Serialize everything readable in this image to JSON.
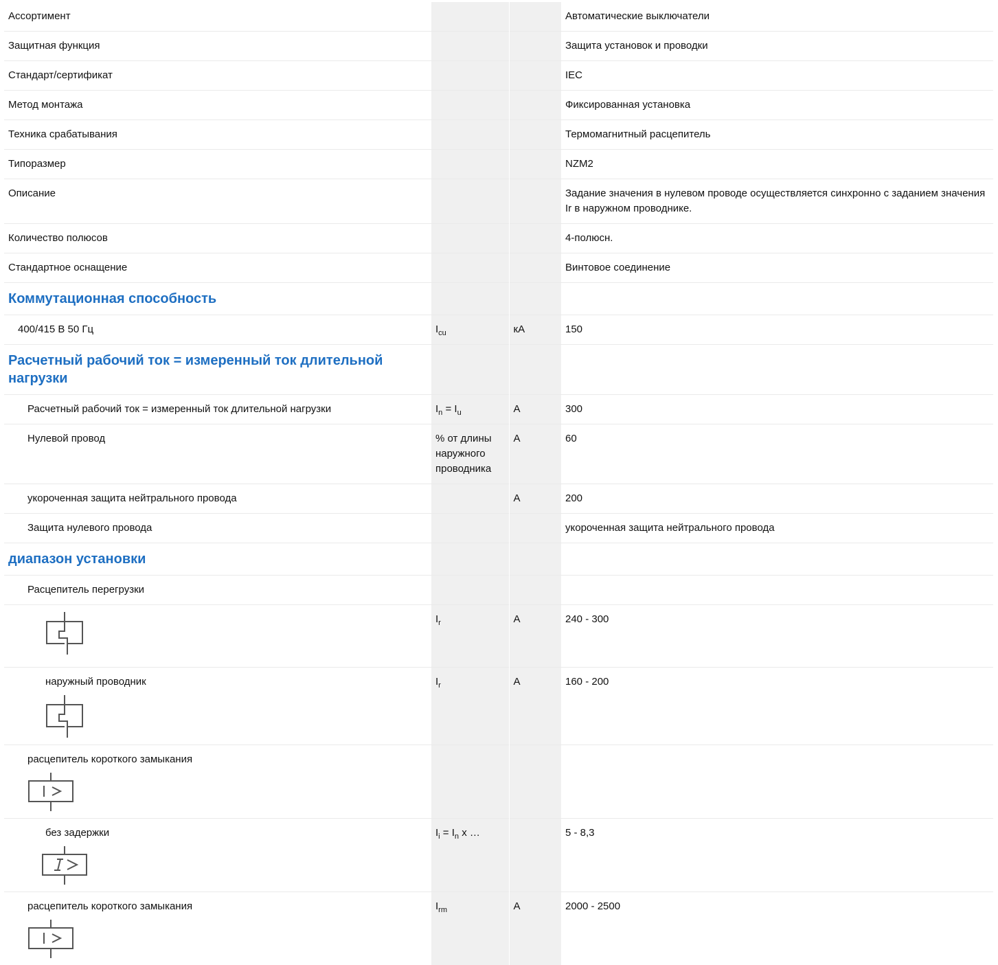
{
  "rows": {
    "r1": {
      "label": "Ассортимент",
      "value": "Автоматические выключатели"
    },
    "r2": {
      "label": "Защитная функция",
      "value": "Защита установок и проводки"
    },
    "r3": {
      "label": "Стандарт/сертификат",
      "value": "IEC"
    },
    "r4": {
      "label": "Метод монтажа",
      "value": "Фиксированная установка"
    },
    "r5": {
      "label": "Техника срабатывания",
      "value": "Термомагнитный расцепитель"
    },
    "r6": {
      "label": "Типоразмер",
      "value": "NZM2"
    },
    "r7": {
      "label": "Описание",
      "value": "Задание значения в нулевом проводе осуществляется синхронно с заданием значения Ir в наружном проводнике."
    },
    "r8": {
      "label": "Количество полюсов",
      "value": "4-полюсн."
    },
    "r9": {
      "label": "Стандартное оснащение",
      "value": "Винтовое соединение"
    }
  },
  "sections": {
    "s1": "Коммутационная способность",
    "s2": "Расчетный рабочий ток = измеренный ток длительной нагрузки",
    "s3": "диапазон установки"
  },
  "breaking": {
    "label": "400/415 В 50 Гц",
    "sym_main": "I",
    "sym_sub": "cu",
    "unit": "кА",
    "value": "150"
  },
  "rated": {
    "main": {
      "label": "Расчетный рабочий ток = измеренный ток длительной нагрузки",
      "sym_a": "I",
      "sym_a_sub": "n",
      "sym_eq": " = ",
      "sym_b": "I",
      "sym_b_sub": "u",
      "unit": "A",
      "value": "300"
    },
    "neutral": {
      "label": "Нулевой провод",
      "sym": "% от длины наружного проводника",
      "unit": "A",
      "value": "60"
    },
    "short_neutral": {
      "label": "укороченная защита нейтрального провода",
      "unit": "A",
      "value": "200"
    },
    "neutral_protection": {
      "label": "Защита нулевого провода",
      "value": "укороченная защита нейтрального провода"
    }
  },
  "setting": {
    "overload": {
      "label": "Расцепитель перегрузки"
    },
    "overload_range": {
      "sym_main": "I",
      "sym_sub": "r",
      "unit": "A",
      "value": "240 - 300"
    },
    "outer_conductor": {
      "label": "наружный проводник",
      "sym_main": "I",
      "sym_sub": "r",
      "unit": "A",
      "value": "160 - 200"
    },
    "short_circuit_1": {
      "label": "расцепитель короткого замыкания"
    },
    "instant": {
      "label": "без задержки",
      "sym_a": "I",
      "sym_a_sub": "i",
      "sym_eq": " = ",
      "sym_b": "I",
      "sym_b_sub": "n",
      "sym_tail": " x …",
      "value": "5 - 8,3"
    },
    "short_circuit_2": {
      "label": "расцепитель короткого замыкания",
      "sym_main": "I",
      "sym_sub": "rm",
      "unit": "A",
      "value": "2000 - 2500"
    }
  },
  "icons": {
    "thermal": "thermal-release-icon",
    "magnetic": "magnetic-release-icon"
  }
}
